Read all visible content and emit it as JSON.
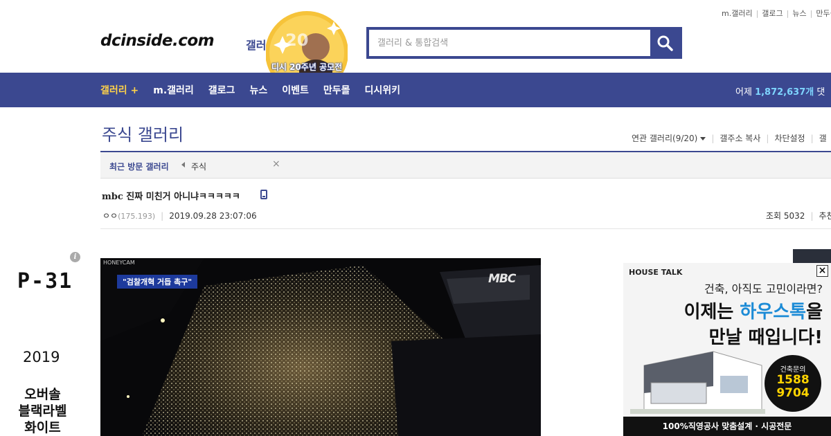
{
  "util_links": [
    "m.갤러리",
    "갤로그",
    "뉴스",
    "만두몰"
  ],
  "logo": {
    "text": "dcinside.com",
    "gallery_label": "갤러리"
  },
  "badge": {
    "number": "20",
    "text": "디시 20주년 공모전"
  },
  "search": {
    "placeholder": "갤러리 & 통합검색",
    "value": ""
  },
  "nav": {
    "items": [
      "갤러리 +",
      "m.갤러리",
      "갤로그",
      "뉴스",
      "이벤트",
      "만두몰",
      "디시위키"
    ],
    "right_prefix": "어제 ",
    "right_count": "1,872,637개",
    "right_suffix": " 댓"
  },
  "gallery": {
    "title": "주식 갤러리",
    "links": [
      "연관 갤러리(9/20)",
      "갤주소 복사",
      "차단설정",
      "갤"
    ]
  },
  "recent": {
    "label": "최근 방문 갤러리",
    "item": "주식",
    "close": "×"
  },
  "post": {
    "title": "mbc 진짜 미친거 아니냐ㅋㅋㅋㅋㅋ",
    "author": "ㅇㅇ",
    "ip": "(175.193)",
    "datetime": "2019.09.28 23:07:06",
    "views": "조회 5032",
    "recommend": "추천"
  },
  "left_ad": {
    "info": "i",
    "code": "P-31",
    "year": "2019",
    "lines": [
      "오버솔",
      "블랙라벨",
      "화이트"
    ]
  },
  "image": {
    "watermark": "HONEYCAM",
    "caption": "\"검찰개혁 거듭 촉구\"",
    "logo": "MBC"
  },
  "right_ad": {
    "brand": "HOUSE TALK",
    "line1": "건축, 아직도 고민이라면?",
    "line2_pre": "이제는 ",
    "line2_hl": "하우스톡",
    "line2_post": "을",
    "line3": "만날 때입니다!",
    "phone_label": "건축문의",
    "phone_1": "1588",
    "phone_2": "9704",
    "bottom": "100%직영공사  맞춤설계 · 시공전문",
    "close": "×"
  },
  "colors": {
    "brand_blue": "#3b4890",
    "active_nav": "#ffd249",
    "count_blue": "#7ed5ff"
  }
}
